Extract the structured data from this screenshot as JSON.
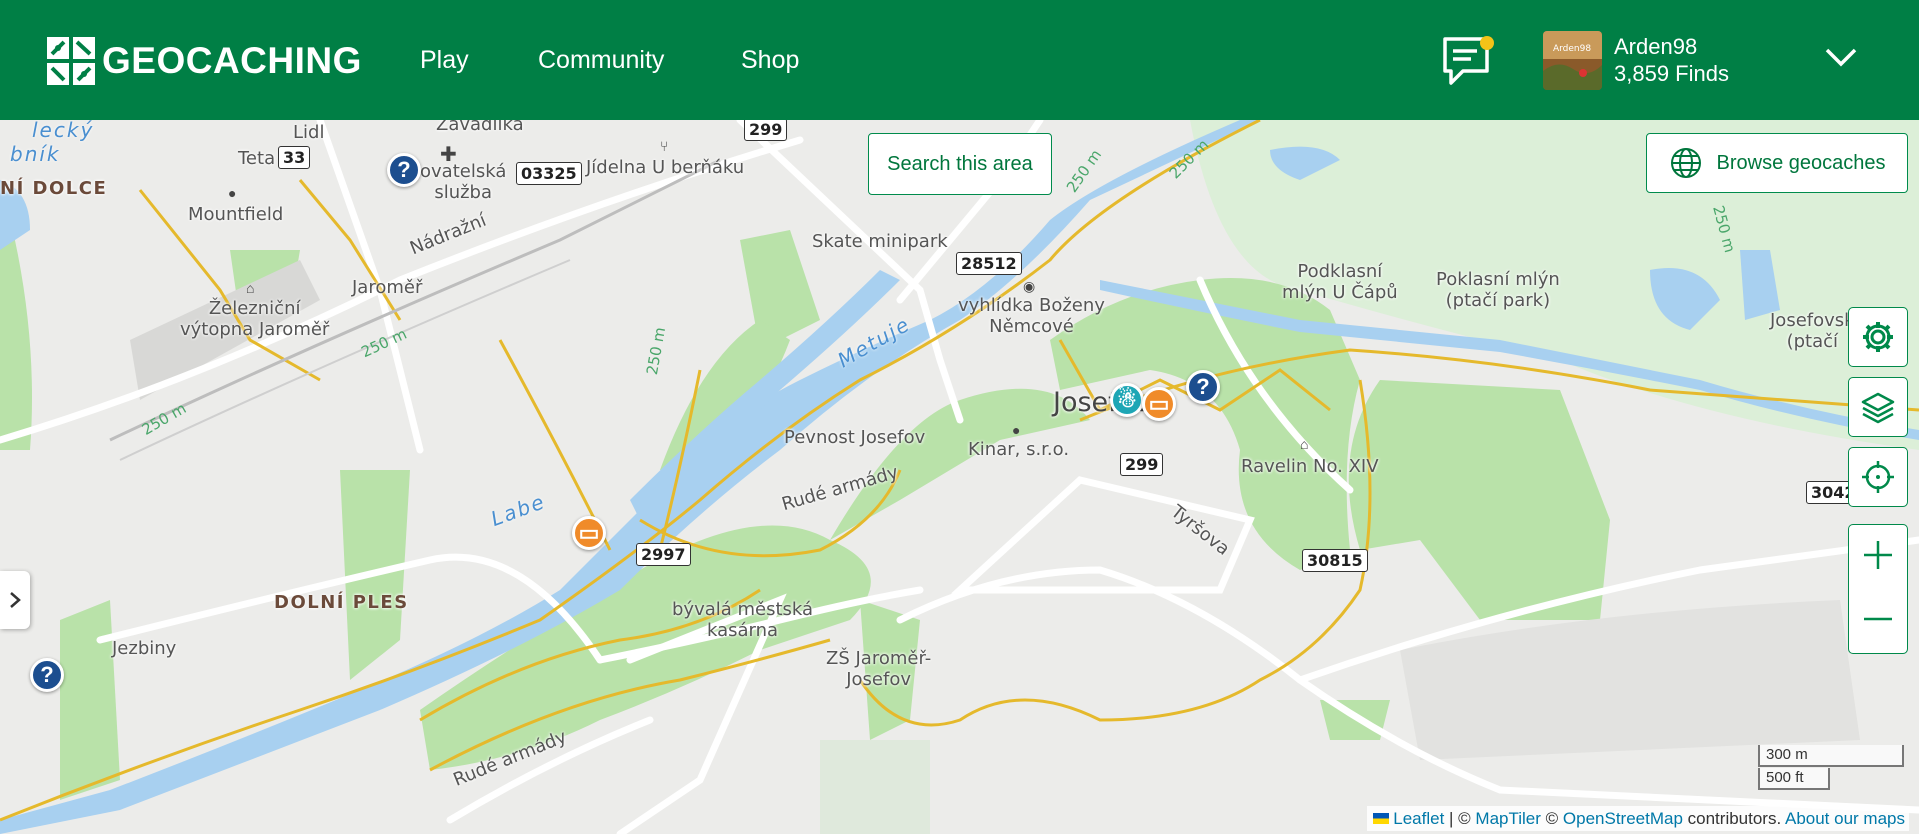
{
  "header": {
    "logo_text": "GEOCACHING",
    "nav": [
      "Play",
      "Community",
      "Shop"
    ],
    "user": {
      "name": "Arden98",
      "finds": "3,859 Finds",
      "avatar_caption": "Arden98"
    }
  },
  "colors": {
    "brand_green": "#007f45",
    "water": "#a8d0f0",
    "park": "#b9e2a9",
    "trail": "#e5b92c"
  },
  "map_controls": {
    "search_area": "Search this area",
    "browse": "Browse geocaches",
    "icons": [
      "settings-gear-icon",
      "layers-icon",
      "locate-icon",
      "zoom-in-icon",
      "zoom-out-icon"
    ]
  },
  "place_labels": {
    "zavadilka": "Zavadilka",
    "lidl": "Lidl",
    "teta": "Teta",
    "mountfield": "Mountfield",
    "ni_dolce": "NÍ DOLCE",
    "lecky": "lecký",
    "bnik": "bník",
    "zachranna": "ovatelská\nslužba",
    "jidelna": "Jídelna U berňáku",
    "skate": "Skate minipark",
    "nadrazni": "Nádražní",
    "jaromer": "Jaroměř",
    "vytopna": "Železniční\nvýtopna Jaroměř",
    "vyhlidka": "vyhlídka Boženy\nNěmcové",
    "podklasni": "Podklasní\nmlýn U Čápů",
    "poklasni": "Poklasní mlýn\n(ptačí park)",
    "josefovsky": "Josefovsk\n(ptačí",
    "josefov": "Josefov",
    "pevnost": "Pevnost Josefov",
    "kinar": "Kinar, s.r.o.",
    "ravelin": "Ravelin No. XIV",
    "rude1": "Rudé armády",
    "rude2": "Rudé armády",
    "tyrsova": "Tyršova",
    "dolni_ples": "DOLNÍ PLES",
    "kasarna": "bývalá městská\nkasárna",
    "zs": "ZŠ Jaroměř-\nJosefov",
    "jezbiny": "Jezbiny"
  },
  "water_labels": {
    "metuje": "Metuje",
    "labe": "Labe"
  },
  "contours": [
    "250 m",
    "250 m",
    "250 m",
    "250 m",
    "250 m",
    "250 m"
  ],
  "road_shields": [
    "299",
    "33",
    "03325",
    "28512",
    "299",
    "2997",
    "30815",
    "3042"
  ],
  "scale": {
    "metric": "300 m",
    "imperial": "500 ft"
  },
  "attribution": {
    "leaflet": "Leaflet",
    "sep1": " | © ",
    "maptiler": "MapTiler",
    "sep2": " © ",
    "osm": "OpenStreetMap",
    "contrib": " contributors. ",
    "about": "About our maps"
  }
}
